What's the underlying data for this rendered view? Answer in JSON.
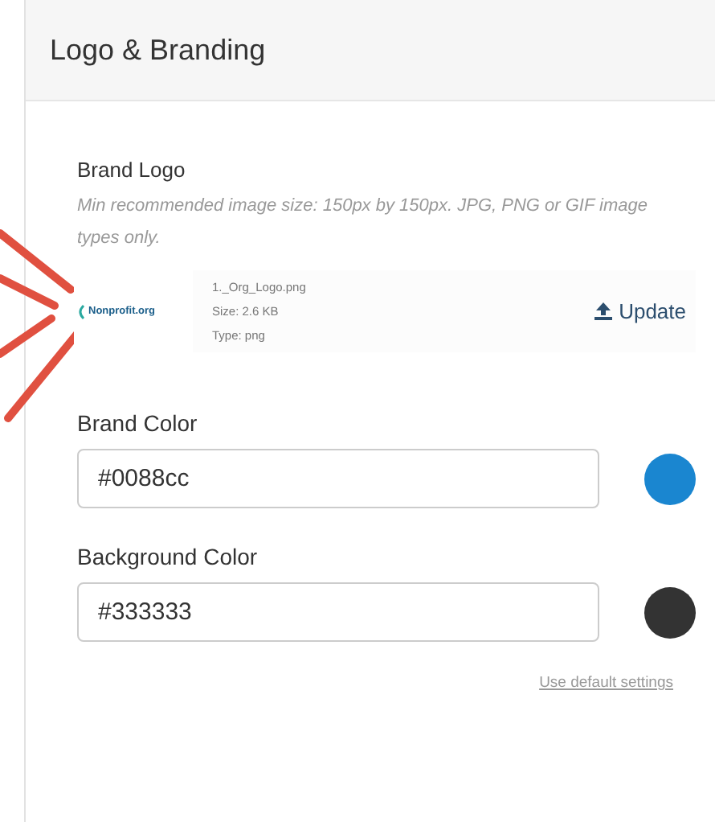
{
  "panel": {
    "title": "Logo & Branding"
  },
  "brand_logo": {
    "label": "Brand Logo",
    "hint": "Min recommended image size: 150px by 150px. JPG, PNG or GIF image types only.",
    "logo_text": "Nonprofit.org",
    "file_name": "1._Org_Logo.png",
    "size": "Size: 2.6 KB",
    "type": "Type: png",
    "update_button": "Update"
  },
  "color_fields": [
    {
      "label": "Brand Color",
      "value": "#0088cc",
      "color": "#1a86d0"
    },
    {
      "label": "Background Color",
      "value": "#333333",
      "color": "#333333"
    }
  ],
  "default_link": "Use default settings"
}
